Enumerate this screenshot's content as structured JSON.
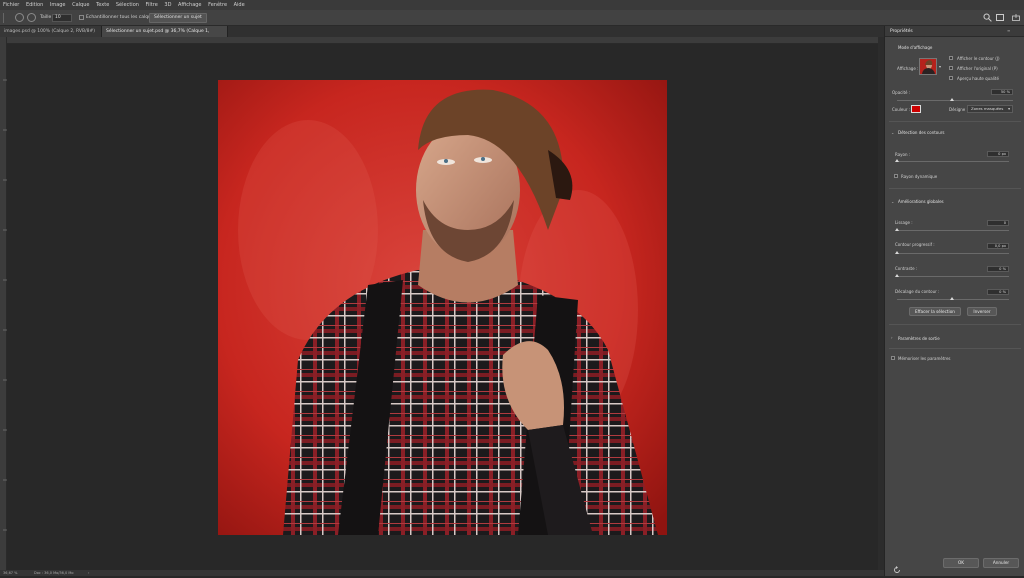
{
  "menu": [
    "Fichier",
    "Edition",
    "Image",
    "Calque",
    "Texte",
    "Sélection",
    "Filtre",
    "3D",
    "Affichage",
    "Fenêtre",
    "Aide"
  ],
  "options_bar": {
    "size_label": "Taille :",
    "size_value": "10",
    "sample_all_label": "Echantillonner tous les calques",
    "select_subject_button": "Sélectionner un sujet"
  },
  "tabs": [
    {
      "label": "images.psd @ 100% (Calque 2, RVB/8#) *",
      "close": "×"
    },
    {
      "label": "Sélectionner un sujet.psd @ 36,7% (Calque 1, RVB/8)",
      "close": "×"
    }
  ],
  "status": {
    "zoom": "36,67 %",
    "doc": "Doc : 36,0 Mo/36,0 Mo"
  },
  "panel": {
    "title": "Propriétés",
    "view_mode": {
      "heading": "Mode d'affichage",
      "display_label": "Affichage :",
      "options": [
        "Afficher le contour (J)",
        "Afficher l'original (P)",
        "Aperçu haute qualité"
      ]
    },
    "opacity_label": "Opacité :",
    "opacity_value": "50 %",
    "color_label": "Couleur :",
    "indicates_label": "Désigne :",
    "indicates_value": "Zones masquées",
    "overlay_color": "#cc0000",
    "edge_detection": {
      "heading": "Détection des contours",
      "radius_label": "Rayon :",
      "radius_value": "0 px",
      "smart_radius_label": "Rayon dynamique"
    },
    "global_refinements": {
      "heading": "Améliorations globales",
      "smooth_label": "Lissage :",
      "smooth_value": "0",
      "feather_label": "Contour progressif :",
      "feather_value": "0,0 px",
      "contrast_label": "Contraste :",
      "contrast_value": "0 %",
      "shift_label": "Décalage du contour :",
      "shift_value": "0 %"
    },
    "clear_selection_button": "Effacer la sélection",
    "invert_button": "Inverser",
    "output_settings": "Paramètres de sortie",
    "remember_settings": "Mémoriser les paramètres",
    "ok_button": "OK",
    "cancel_button": "Annuler"
  }
}
